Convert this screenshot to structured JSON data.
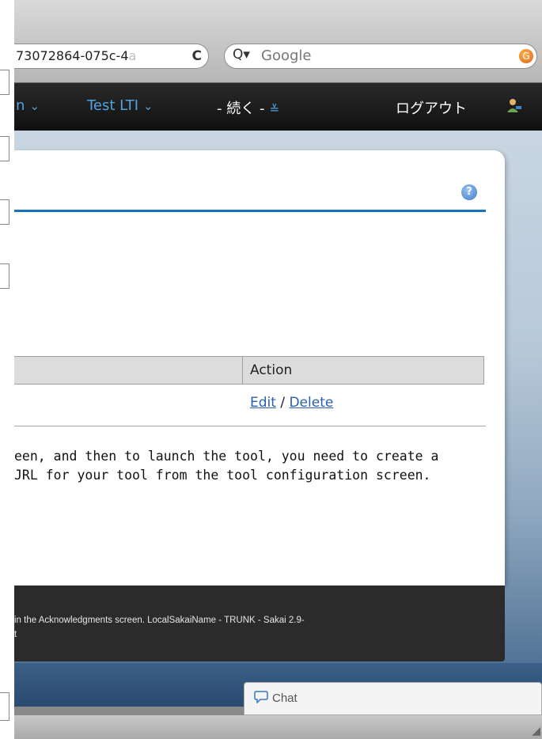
{
  "browser": {
    "url_visible": "73072864-075c-4",
    "url_faded": "a",
    "reload_glyph": "C",
    "search_placeholder": "Google",
    "search_glass": "Q▾",
    "search_engine_glyph": "G"
  },
  "topnav": {
    "item1_partial": "n",
    "item2": "Test LTI",
    "item3": "- 続く -",
    "logout": "ログアウト",
    "chevron": "⌄",
    "double_chevron": "≚"
  },
  "card": {
    "help_glyph": "?",
    "table": {
      "action_header": "Action",
      "row_edit": "Edit",
      "row_separator": " / ",
      "row_delete": "Delete"
    },
    "help_line1": "een, and then to launch the tool, you need to create a",
    "help_line2": "JRL for your tool from the tool configuration screen."
  },
  "footer": {
    "line1": "in the Acknowledgments screen. LocalSakaiName - TRUNK - Sakai 2.9-",
    "line2": "t"
  },
  "chat": {
    "label": "Chat"
  },
  "colors": {
    "accent_blue": "#1b72b9",
    "nav_blue": "#4fa3e0",
    "link_blue": "#2a5fb0",
    "footer_bg": "#2b2b2b"
  }
}
